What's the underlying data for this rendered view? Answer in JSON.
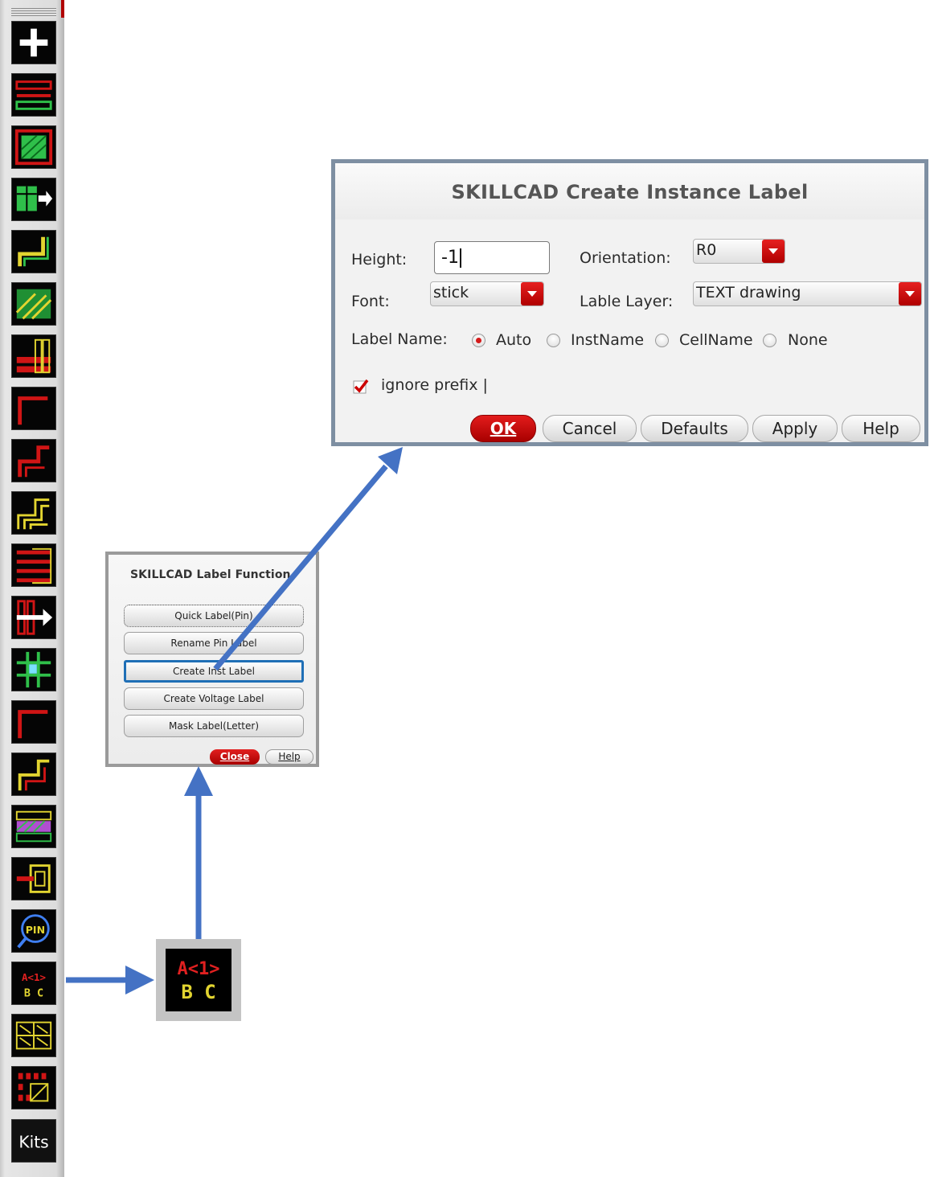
{
  "toolbar": {
    "tools": [
      {
        "icon": "add-icon"
      },
      {
        "icon": "wire-bar-icon"
      },
      {
        "icon": "hatched-rect-icon"
      },
      {
        "icon": "move-shape-icon"
      },
      {
        "icon": "step-route-icon"
      },
      {
        "icon": "hatched-shape-icon"
      },
      {
        "icon": "stacked-bars-icon"
      },
      {
        "icon": "path-corner-icon"
      },
      {
        "icon": "double-step-icon"
      },
      {
        "icon": "triple-step-icon"
      },
      {
        "icon": "bus-lines-icon"
      },
      {
        "icon": "shift-arrow-icon"
      },
      {
        "icon": "cross-grid-icon"
      },
      {
        "icon": "path-corner-icon"
      },
      {
        "icon": "double-step-icon"
      },
      {
        "icon": "layer-stack-icon"
      },
      {
        "icon": "connector-icon"
      },
      {
        "icon": "pin-search-icon"
      },
      {
        "icon": "label-abc-icon"
      },
      {
        "icon": "text-grid-icon"
      },
      {
        "icon": "binary-grid-icon"
      },
      {
        "icon": "kits-icon"
      }
    ],
    "kits_label": "Kits"
  },
  "big_tool": {
    "line1": "A<1>",
    "line2": "B C"
  },
  "small_dialog": {
    "title": "SKILLCAD Label Function",
    "buttons": [
      "Quick Label(Pin)",
      "Rename Pin Label",
      "Create Inst Label",
      "Create Voltage Label",
      "Mask Label(Letter)"
    ],
    "close": "Close",
    "help": "Help"
  },
  "main_dialog": {
    "title": "SKILLCAD Create Instance Label",
    "height_label": "Height:",
    "height_value": "-1",
    "orientation_label": "Orientation:",
    "orientation_value": "R0",
    "font_label": "Font:",
    "font_value": "stick",
    "layer_label": "Lable Layer:",
    "layer_value": "TEXT drawing",
    "label_name_label": "Label Name:",
    "label_name_options": [
      "Auto",
      "InstName",
      "CellName",
      "None"
    ],
    "label_name_selected": "Auto",
    "ignore_prefix_label": "ignore prefix |",
    "ignore_prefix_checked": true,
    "buttons": {
      "ok": "OK",
      "cancel": "Cancel",
      "defaults": "Defaults",
      "apply": "Apply",
      "help": "Help"
    }
  },
  "colors": {
    "accent_red": "#c00000",
    "highlight_blue": "#1f6fb6",
    "arrow_blue": "#4472c4"
  }
}
